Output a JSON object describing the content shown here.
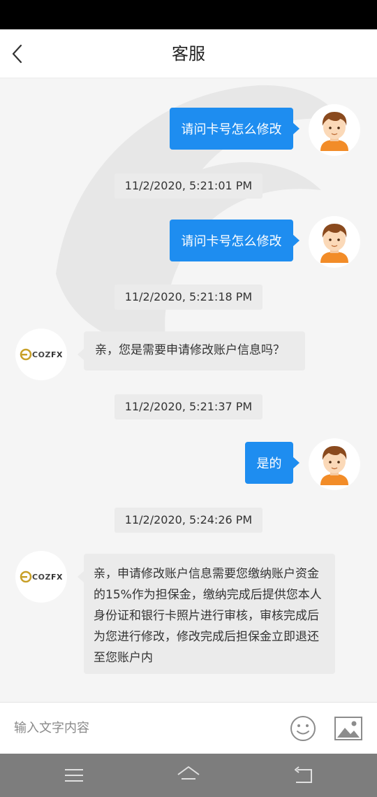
{
  "header": {
    "title": "客服"
  },
  "messages": [
    {
      "type": "out",
      "text": "请问卡号怎么修改",
      "timestamp": "11/2/2020, 5:21:01 PM"
    },
    {
      "type": "out",
      "text": "请问卡号怎么修改",
      "timestamp": "11/2/2020, 5:21:18 PM"
    },
    {
      "type": "in",
      "text": "亲，您是需要申请修改账户信息吗？",
      "timestamp": "11/2/2020, 5:21:37 PM"
    },
    {
      "type": "out",
      "text": "是的",
      "timestamp": "11/2/2020, 5:24:26 PM"
    },
    {
      "type": "in",
      "text": "亲，申请修改账户信息需要您缴纳账户资金的15%作为担保金，缴纳完成后提供您本人身份证和银行卡照片进行审核，审核完成后为您进行修改，修改完成后担保金立即退还至您账户内"
    }
  ],
  "agent": {
    "brand_prefix": "COZ",
    "brand_suffix": "FX"
  },
  "input": {
    "placeholder": "输入文字内容"
  },
  "colors": {
    "outgoing_bubble": "#1e8df0",
    "incoming_bubble": "#ebebeb",
    "nav_bar": "#7d7d7d"
  }
}
